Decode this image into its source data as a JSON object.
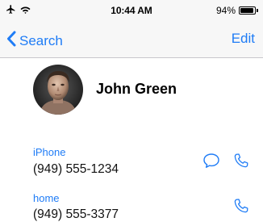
{
  "status_bar": {
    "time": "10:44 AM",
    "battery_percent": "94%",
    "battery_level": 0.94,
    "icons": [
      "airplane-mode-icon",
      "wifi-icon",
      "battery-icon"
    ]
  },
  "nav": {
    "back_label": "Search",
    "edit_label": "Edit"
  },
  "contact": {
    "name": "John Green",
    "phones": [
      {
        "label": "iPhone",
        "number": "(949) 555-1234",
        "actions": [
          "message-icon",
          "phone-icon"
        ]
      },
      {
        "label": "home",
        "number": "(949) 555-3377",
        "actions": [
          "phone-icon"
        ]
      }
    ]
  },
  "colors": {
    "accent": "#1f7cf6",
    "bar_background": "#f7f7f7",
    "separator": "#c8c7cc"
  }
}
